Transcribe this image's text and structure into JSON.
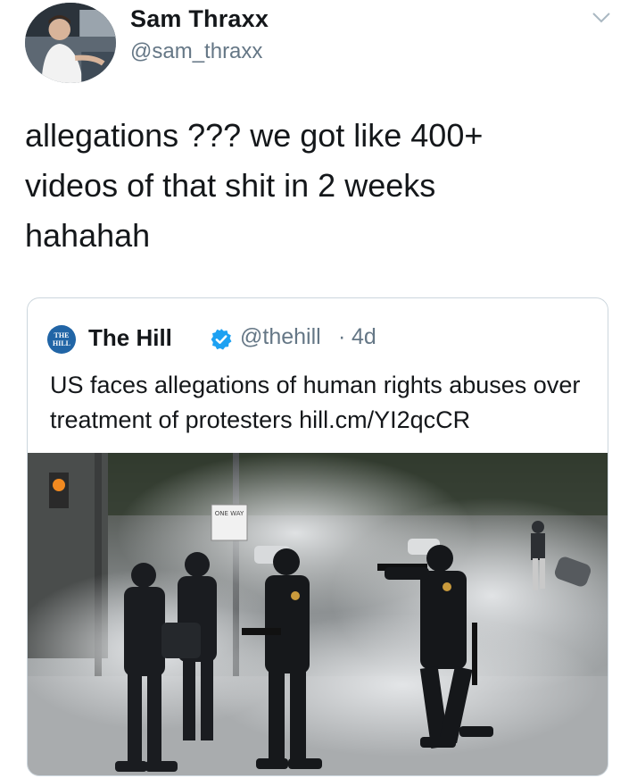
{
  "tweet": {
    "author": {
      "display_name": "Sam Thraxx",
      "handle": "@sam_thraxx"
    },
    "menu_icon": "chevron-down-icon",
    "text": "allegations ??? we got like 400+\nvideos of that shit in 2 weeks\nhahahah"
  },
  "quoted_tweet": {
    "logo_text": "THE HILL",
    "display_name": "The Hill",
    "verified_icon": "verified-badge-icon",
    "handle": "@thehill",
    "separator": "·",
    "time": "4d",
    "text": "US faces allegations of human rights abuses over treatment of protesters hill.cm/YI2qcCR",
    "photo": {
      "signs": [
        "ONE WAY"
      ]
    }
  },
  "colors": {
    "text": "#14171a",
    "secondary": "#657786",
    "border": "#ccd6dd",
    "verified": "#1da1f2",
    "hill_blue": "#2165a6"
  }
}
